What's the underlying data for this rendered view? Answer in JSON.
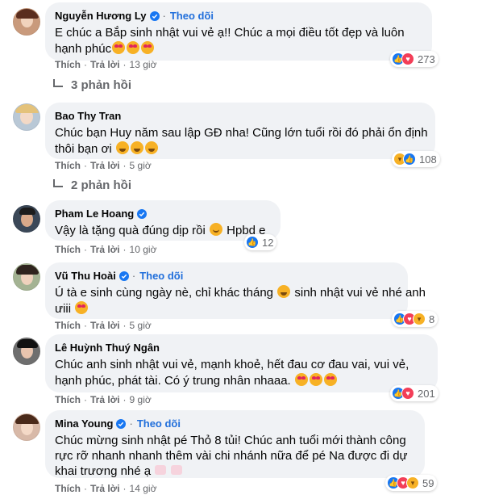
{
  "labels": {
    "like": "Thích",
    "reply": "Trả lời",
    "follow": "Theo dõi"
  },
  "comments": [
    {
      "name": "Nguyễn Hương Ly",
      "verified": true,
      "follow": true,
      "lines": [
        "E chúc a Bắp sinh nhật vui vẻ ạ!! Chúc a mọi điều tốt đẹp và luôn",
        "hạnh phúc"
      ],
      "time": "13 giờ",
      "reaction_count": "273",
      "replies": "3 phản hồi"
    },
    {
      "name": "Bao Thy Tran",
      "verified": false,
      "follow": false,
      "lines": [
        "Chúc bạn Huy năm sau lập GĐ nha! Cũng lớn tuổi rồi đó phải ổn định",
        "thôi bạn ơi"
      ],
      "time": "5 giờ",
      "reaction_count": "108",
      "replies": "2 phản hồi"
    },
    {
      "name": "Pham Le Hoang",
      "verified": true,
      "follow": false,
      "lines": [
        "Vậy là tặng quà đúng dịp rồi",
        "Hpbd e"
      ],
      "time": "10 giờ",
      "reaction_count": "12"
    },
    {
      "name": "Vũ Thu Hoài",
      "verified": true,
      "follow": true,
      "lines": [
        "Ú tà e sinh cùng ngày nè, chỉ khác tháng",
        "sinh nhật vui vẻ nhé anh",
        "ưiii"
      ],
      "time": "5 giờ",
      "reaction_count": "8"
    },
    {
      "name": "Lê Huỳnh Thuý Ngân",
      "verified": false,
      "follow": false,
      "lines": [
        "Chúc anh sinh nhật vui vẻ, mạnh khoẻ, hết đau cơ đau vai, vui vẻ,",
        "hạnh phúc, phát tài. Có ý trung nhân nhaaa."
      ],
      "time": "9 giờ",
      "reaction_count": "201"
    },
    {
      "name": "Mina Young",
      "verified": true,
      "follow": true,
      "lines": [
        "Chúc mừng sinh nhật pé Thỏ 8 tủi! Chúc anh tuổi mới thành công",
        "rực rỡ nhanh nhanh thêm vài chi nhánh nữa để pé Na được đi dự",
        "khai trương nhé ạ"
      ],
      "time": "14 giờ",
      "reaction_count": "59"
    }
  ],
  "colors": {
    "bubble": "#f0f2f5",
    "link": "#216fdb",
    "meta": "#65676b",
    "like": "#1877f2",
    "love": "#f33e58",
    "haha": "#f7b125"
  }
}
